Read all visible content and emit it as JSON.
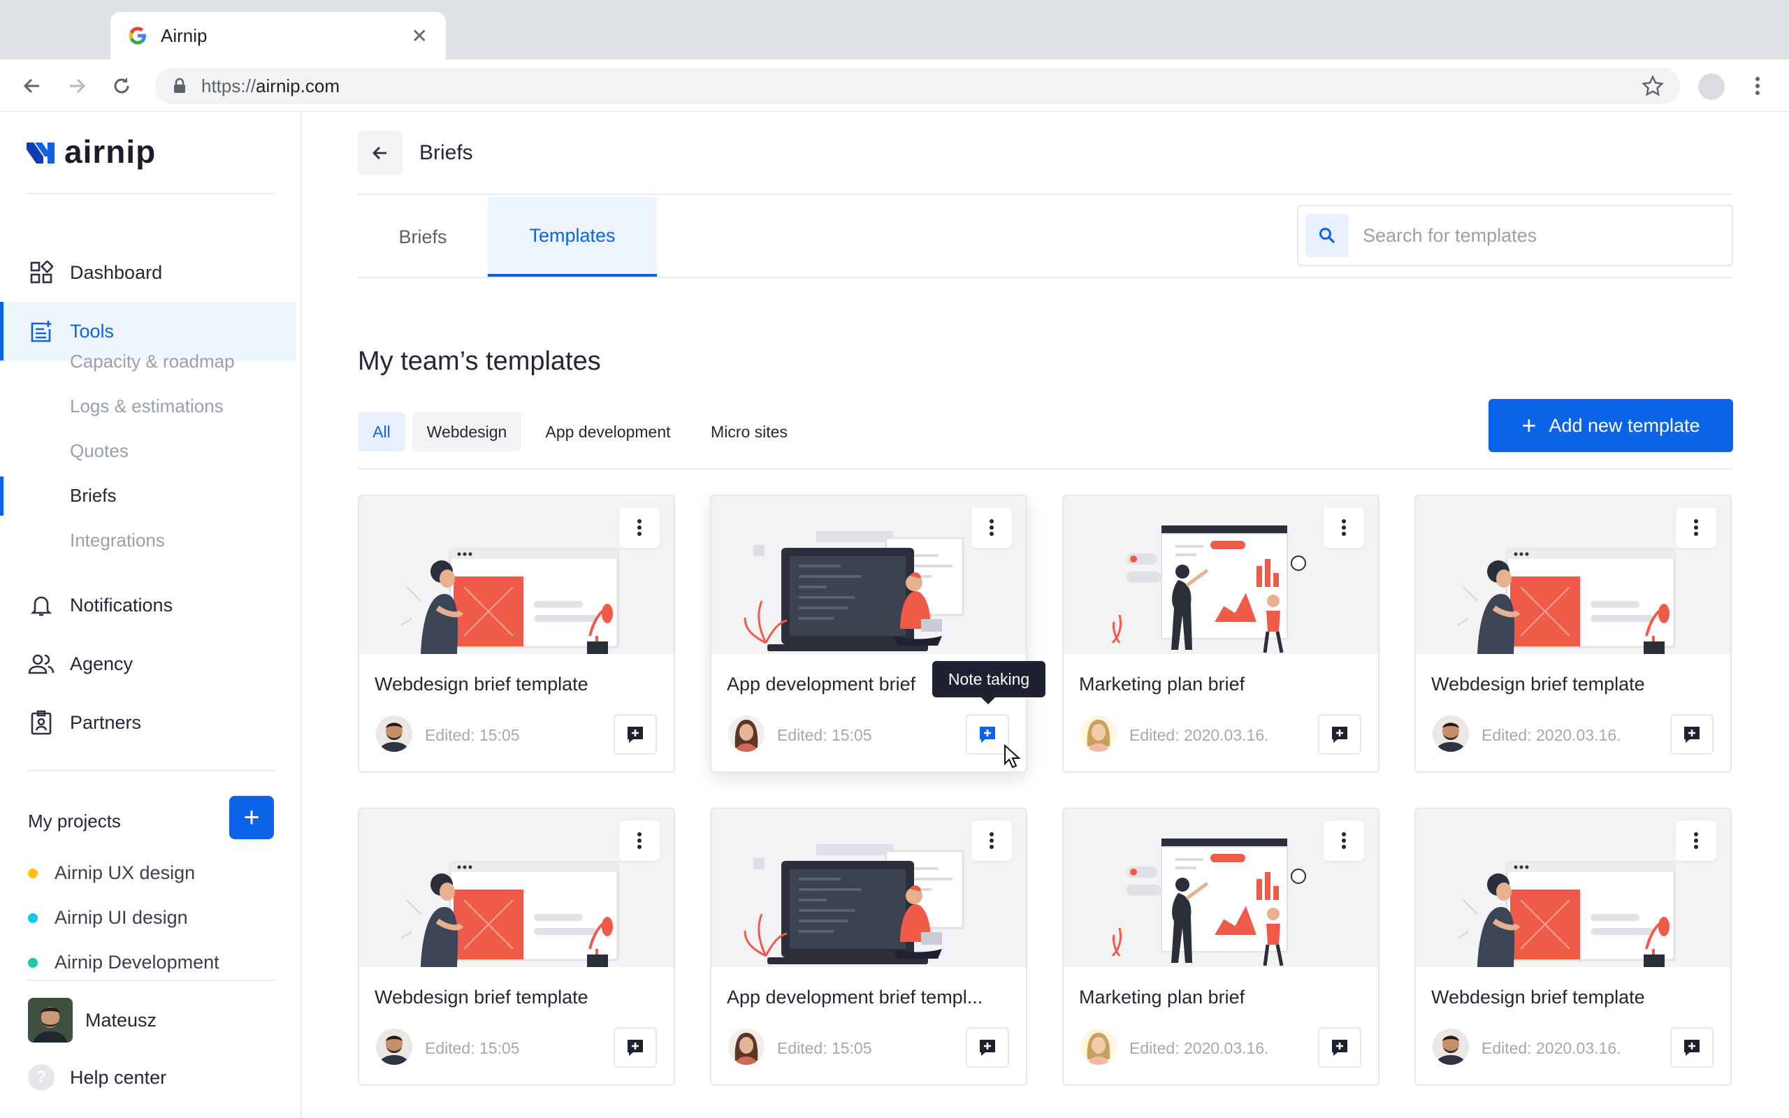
{
  "browser": {
    "tab_title": "Airnip",
    "url_scheme": "https://",
    "url_host": "airnip.com"
  },
  "sidebar": {
    "logo_text": "airnip",
    "nav": [
      {
        "label": "Dashboard",
        "icon": "grid-icon"
      },
      {
        "label": "Tools",
        "icon": "tools-icon",
        "active": true
      },
      {
        "label": "Notifications",
        "icon": "bell-icon"
      },
      {
        "label": "Agency",
        "icon": "people-icon"
      },
      {
        "label": "Partners",
        "icon": "badge-icon"
      }
    ],
    "tools_sub": [
      "Capacity & roadmap",
      "Logs & estimations",
      "Quotes",
      "Briefs",
      "Integrations"
    ],
    "projects_title": "My projects",
    "projects": [
      {
        "label": "Airnip UX design",
        "color": "#ffc107"
      },
      {
        "label": "Airnip UI design",
        "color": "#18c4e8"
      },
      {
        "label": "Airnip Development",
        "color": "#22c7a6"
      }
    ],
    "user_name": "Mateusz",
    "help_label": "Help center"
  },
  "header": {
    "title": "Briefs"
  },
  "tabs": [
    "Briefs",
    "Templates"
  ],
  "search": {
    "placeholder": "Search for templates"
  },
  "section_title": "My team’s templates",
  "filters": [
    "All",
    "Webdesign",
    "App development",
    "Micro sites"
  ],
  "add_button_label": "Add new template",
  "tooltip": "Note taking",
  "colors": {
    "accent": "#0b63e8",
    "illustration": "#f05a48"
  },
  "cards": [
    {
      "title": "Webdesign brief template",
      "edited": "Edited: 15:05",
      "art": "webdesign",
      "avatar": "man"
    },
    {
      "title": "App development brief",
      "edited": "Edited: 15:05",
      "art": "appdev",
      "avatar": "woman"
    },
    {
      "title": "Marketing plan brief",
      "edited": "Edited: 2020.03.16.",
      "art": "marketing",
      "avatar": "girl"
    },
    {
      "title": "Webdesign brief template",
      "edited": "Edited: 2020.03.16.",
      "art": "webdesign",
      "avatar": "man"
    },
    {
      "title": "Webdesign brief template",
      "edited": "Edited: 15:05",
      "art": "webdesign",
      "avatar": "man"
    },
    {
      "title": "App development brief templ...",
      "edited": "Edited: 15:05",
      "art": "appdev",
      "avatar": "woman"
    },
    {
      "title": "Marketing plan brief",
      "edited": "Edited: 2020.03.16.",
      "art": "marketing",
      "avatar": "girl"
    },
    {
      "title": "Webdesign brief template",
      "edited": "Edited: 2020.03.16.",
      "art": "webdesign",
      "avatar": "man"
    }
  ]
}
